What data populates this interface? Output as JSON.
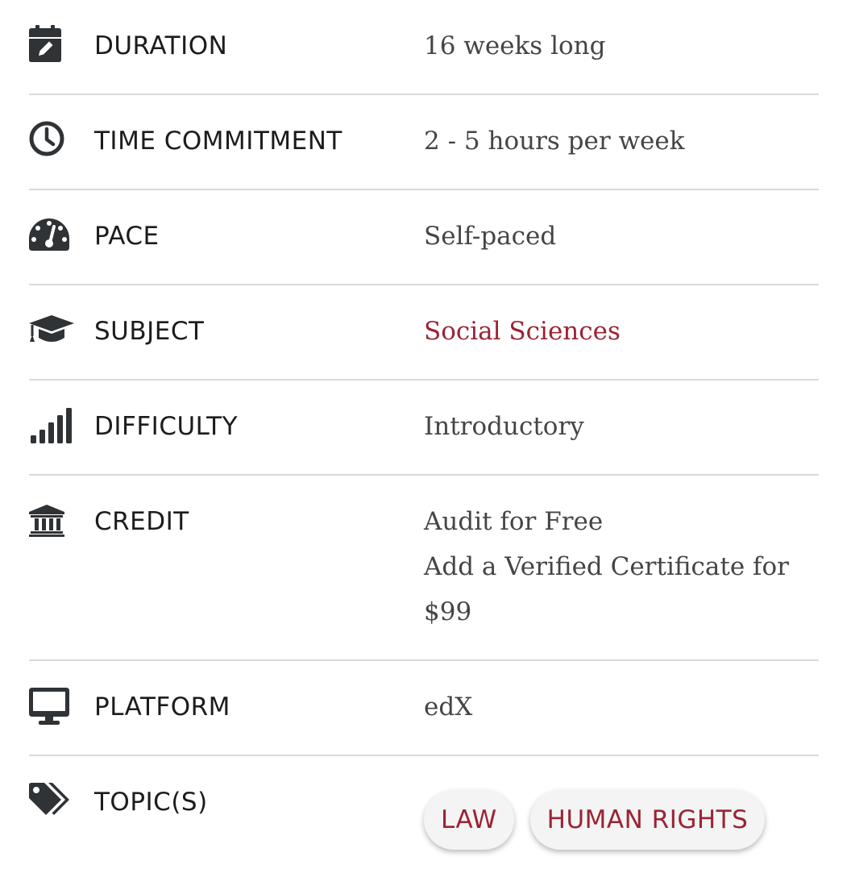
{
  "details": [
    {
      "label": "DURATION",
      "icon": "calendar-edit-icon",
      "value": "16 weeks long"
    },
    {
      "label": "TIME COMMITMENT",
      "icon": "clock-icon",
      "value": "2 - 5 hours per week"
    },
    {
      "label": "PACE",
      "icon": "speedometer-icon",
      "value": "Self-paced"
    },
    {
      "label": "SUBJECT",
      "icon": "graduation-cap-icon",
      "value": "Social Sciences"
    },
    {
      "label": "DIFFICULTY",
      "icon": "signal-bars-icon",
      "value": "Introductory"
    },
    {
      "label": "CREDIT",
      "icon": "institution-icon",
      "value_lines": [
        "Audit for Free",
        "Add a Verified Certificate for",
        "$99"
      ]
    },
    {
      "label": "PLATFORM",
      "icon": "desktop-monitor-icon",
      "value": "edX"
    },
    {
      "label": "TOPIC(S)",
      "icon": "tags-icon",
      "topics": [
        "LAW",
        "HUMAN RIGHTS"
      ]
    }
  ],
  "colors": {
    "link": "#9b2335",
    "icon": "#2f3336",
    "divider": "#d9d9d9",
    "chip_bg": "#f4f4f4"
  }
}
